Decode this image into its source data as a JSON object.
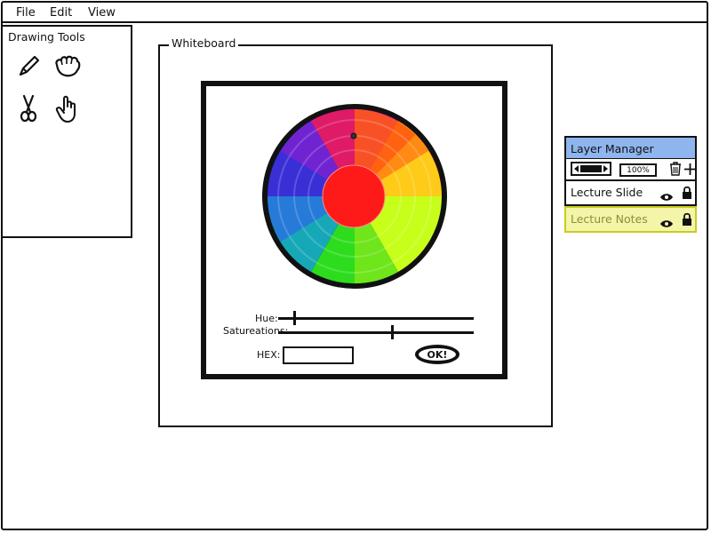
{
  "menu": {
    "file": "File",
    "edit": "Edit",
    "view": "View"
  },
  "toolbox": {
    "title": "Drawing Tools",
    "tools": [
      "pencil-icon",
      "glove-icon",
      "scissors-icon",
      "hand-icon"
    ]
  },
  "whiteboard": {
    "title": "Whiteboard"
  },
  "color_picker": {
    "hue_label": "Hue:",
    "saturation_label": "Satureations:",
    "hue_value": 0.1,
    "saturation_value": 0.6,
    "hex_label": "HEX:",
    "hex_value": "",
    "ok_label": "OK!",
    "selected_color": "#ff1a1a"
  },
  "layer_manager": {
    "title": "Layer Manager",
    "zoom": "100%",
    "layers": [
      {
        "name": "Lecture Slide",
        "highlighted": false
      },
      {
        "name": "Lecture Notes",
        "highlighted": true
      }
    ],
    "header_color": "#8fb5ee",
    "highlight_color": "#f4f5a8",
    "highlight_border": "#c8cc1e",
    "highlight_text": "#8b8f3a"
  }
}
